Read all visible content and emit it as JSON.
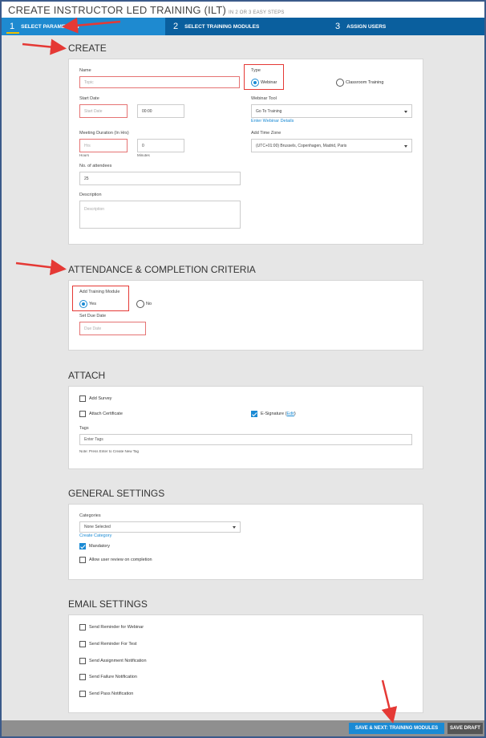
{
  "header": {
    "title": "CREATE INSTRUCTOR LED TRAINING (ILT)",
    "subtitle": "IN 2 OR 3 EASY STEPS"
  },
  "steps": [
    {
      "num": "1",
      "label": "SELECT PARAMETERS"
    },
    {
      "num": "2",
      "label": "SELECT TRAINING MODULES"
    },
    {
      "num": "3",
      "label": "ASSIGN USERS"
    }
  ],
  "create": {
    "title": "CREATE",
    "name_label": "Name",
    "name_placeholder": "Topic",
    "type_label": "Type",
    "type_webinar": "Webinar",
    "type_classroom": "Classroom Training",
    "start_date_label": "Start Date",
    "start_date_placeholder": "Start Date",
    "start_time": "00:00",
    "webinar_tool_label": "Webinar Tool",
    "webinar_tool_value": "Go To Training",
    "enter_webinar_details": "Enter Webinar Details",
    "duration_label": "Meeting Duration (In Hrs)",
    "hours_placeholder": "Hrs",
    "minutes_value": "0",
    "hours_caption": "Hours",
    "minutes_caption": "Minutes",
    "timezone_label": "Add Time Zone",
    "timezone_value": "(UTC+01:00) Brussels, Copenhagen, Madrid, Paris",
    "attendees_label": "No. of attendees",
    "attendees_value": "25",
    "description_label": "Description",
    "description_placeholder": "Description"
  },
  "attendance": {
    "title": "ATTENDANCE & COMPLETION CRITERIA",
    "add_module_label": "Add Training Module",
    "yes": "Yes",
    "no": "No",
    "due_date_label": "Set Due Date",
    "due_date_placeholder": "Due Date"
  },
  "attach": {
    "title": "ATTACH",
    "add_survey": "Add Survey",
    "attach_certificate": "Attach Certificate",
    "esignature": "E-Signature (",
    "esignature_edit": "Edit",
    "esignature_close": ")",
    "tags_label": "Tags",
    "tags_placeholder": "Enter Tags",
    "tags_note": "Note: Press Enter to Create New Tag"
  },
  "general": {
    "title": "GENERAL SETTINGS",
    "categories_label": "Categories",
    "categories_value": "None Selected",
    "create_category": "Create Category",
    "mandatory": "Mandatory",
    "allow_review": "Allow user review on completion"
  },
  "email": {
    "title": "EMAIL SETTINGS",
    "items": [
      "Send Reminder for Webinar",
      "Send Reminder For Test",
      "Send Assignment Notification",
      "Send Failure Notification",
      "Send Pass Notification"
    ]
  },
  "footer": {
    "next_button": "SAVE & NEXT: TRAINING MODULES",
    "draft_button": "SAVE DRAFT"
  },
  "colors": {
    "accent": "#1a8ad4",
    "step_bar": "#0a5f9e",
    "highlight": "#e53935"
  }
}
